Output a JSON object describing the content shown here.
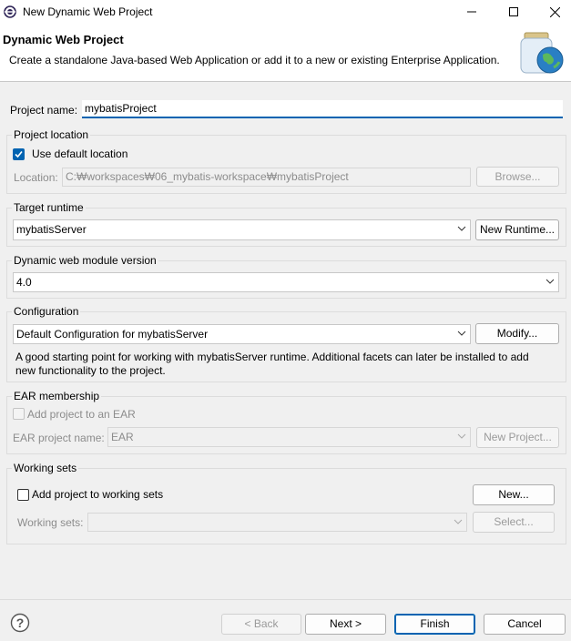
{
  "window": {
    "title": "New Dynamic Web Project",
    "icons": {
      "app": "eclipse-icon",
      "minimize": "minimize-icon",
      "maximize": "maximize-icon",
      "close": "close-icon"
    }
  },
  "banner": {
    "title": "Dynamic Web Project",
    "description": "Create a standalone Java-based Web Application or add it to a new or existing Enterprise Application.",
    "icon": "jar-globe-icon"
  },
  "project_name": {
    "label": "Project name:",
    "value": "mybatisProject"
  },
  "project_location": {
    "group_title": "Project location",
    "use_default_label": "Use default location",
    "use_default_checked": true,
    "location_label": "Location:",
    "location_value": "C:₩workspaces₩06_mybatis-workspace₩mybatisProject",
    "browse_label": "Browse..."
  },
  "target_runtime": {
    "group_title": "Target runtime",
    "selected": "mybatisServer",
    "new_runtime_label": "New Runtime..."
  },
  "module_version": {
    "group_title": "Dynamic web module version",
    "selected": "4.0"
  },
  "configuration": {
    "group_title": "Configuration",
    "selected": "Default Configuration for mybatisServer",
    "modify_label": "Modify...",
    "description_line1": "A good starting point for working with mybatisServer runtime. Additional facets can later be installed to add",
    "description_line2": "new functionality to the project."
  },
  "ear": {
    "group_title": "EAR membership",
    "add_label": "Add project to an EAR",
    "add_checked": false,
    "project_name_label": "EAR project name:",
    "project_name_value": "EAR",
    "new_project_label": "New Project..."
  },
  "working_sets": {
    "group_title": "Working sets",
    "add_label": "Add project to working sets",
    "add_checked": false,
    "new_label": "New...",
    "sets_label": "Working sets:",
    "sets_value": "",
    "select_label": "Select..."
  },
  "footer": {
    "help_icon": "help-icon",
    "back_label": "< Back",
    "next_label": "Next >",
    "finish_label": "Finish",
    "cancel_label": "Cancel"
  },
  "colors": {
    "accent": "#0063b1",
    "banner_bg": "#ffffff",
    "dialog_bg": "#f0f0f0"
  }
}
